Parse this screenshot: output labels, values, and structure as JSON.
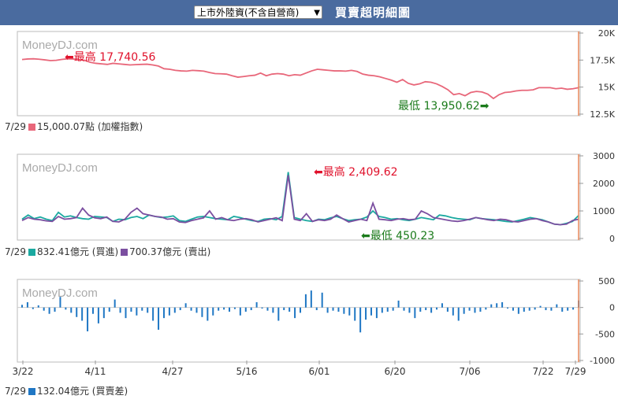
{
  "header": {
    "select_value": "上市外陸資(不含自營商)",
    "title": "買賣超明細圖"
  },
  "watermark": "MoneyDJ.com",
  "colors": {
    "header_bg": "#4a6b9f",
    "index_line": "#e8677a",
    "buy": "#1ba9a0",
    "sell": "#7b4fa0",
    "diff": "#1f77c4",
    "high_text": "#e0112b",
    "low_text": "#1a7a1a",
    "cursor": "#e8885a"
  },
  "chart_data": [
    {
      "type": "line",
      "name": "index",
      "y_ticks": [
        "20K",
        "17.5K",
        "15K",
        "12.5K"
      ],
      "ylim": [
        12500,
        20000
      ],
      "values": [
        17550,
        17600,
        17620,
        17580,
        17520,
        17450,
        17480,
        17560,
        17620,
        17600,
        17550,
        17480,
        17300,
        17200,
        17150,
        17100,
        17200,
        17150,
        17100,
        17050,
        17080,
        17100,
        17120,
        17050,
        16950,
        16700,
        16650,
        16550,
        16500,
        16480,
        16550,
        16520,
        16480,
        16350,
        16250,
        16230,
        16200,
        16050,
        15920,
        15980,
        16050,
        16100,
        16300,
        16050,
        16200,
        16250,
        16200,
        16050,
        16150,
        16100,
        16300,
        16500,
        16650,
        16600,
        16550,
        16500,
        16500,
        16480,
        16550,
        16450,
        16200,
        16100,
        16050,
        15950,
        15800,
        15650,
        15450,
        15700,
        15350,
        15200,
        15300,
        15500,
        15450,
        15300,
        15050,
        14750,
        14300,
        14400,
        14200,
        14500,
        14600,
        14550,
        14350,
        13950,
        14300,
        14500,
        14550,
        14650,
        14700,
        14700,
        14750,
        14950,
        14950,
        14950,
        14850,
        14900,
        14800,
        14850,
        14950
      ],
      "high_label": "最高 17,740.56",
      "low_label": "最低 13,950.62",
      "legend": "15,000.07點 (加權指數)",
      "date": "7/29"
    },
    {
      "type": "line",
      "name": "buy_sell",
      "y_ticks": [
        "3000",
        "2000",
        "1000",
        "0"
      ],
      "ylim": [
        0,
        3000
      ],
      "series": [
        {
          "name": "買進",
          "values": [
            700,
            850,
            720,
            780,
            700,
            650,
            950,
            780,
            820,
            760,
            720,
            700,
            800,
            780,
            760,
            620,
            700,
            680,
            760,
            800,
            720,
            850,
            800,
            760,
            780,
            820,
            650,
            620,
            700,
            780,
            800,
            760,
            720,
            700,
            680,
            800,
            760,
            700,
            650,
            620,
            700,
            720,
            680,
            800,
            2409.62,
            760,
            700,
            650,
            620,
            700,
            680,
            750,
            800,
            720,
            650,
            680,
            700,
            780,
            1000,
            800,
            760,
            700,
            720,
            680,
            650,
            700,
            760,
            720,
            680,
            850,
            820,
            760,
            720,
            700,
            680,
            760,
            720,
            700,
            680,
            650,
            620,
            600,
            650,
            700,
            760,
            720,
            680,
            600,
            520,
            500,
            550,
            620,
            832.41
          ]
        },
        {
          "name": "賣出",
          "values": [
            650,
            760,
            700,
            680,
            640,
            620,
            800,
            700,
            720,
            760,
            1100,
            850,
            750,
            720,
            780,
            620,
            600,
            700,
            950,
            1100,
            900,
            850,
            800,
            780,
            700,
            720,
            600,
            580,
            650,
            700,
            750,
            1000,
            700,
            760,
            680,
            650,
            700,
            720,
            680,
            600,
            650,
            700,
            750,
            650,
            2300,
            700,
            650,
            900,
            620,
            680,
            650,
            700,
            850,
            720,
            600,
            650,
            700,
            650,
            1280,
            700,
            680,
            650,
            700,
            720,
            680,
            700,
            1000,
            900,
            760,
            720,
            680,
            640,
            620,
            650,
            700,
            760,
            720,
            680,
            650,
            700,
            680,
            620,
            600,
            650,
            700,
            720,
            650,
            600,
            520,
            500,
            520,
            650,
            700.37
          ]
        }
      ],
      "high_label": "最高 2,409.62",
      "low_label": "最低 450.23",
      "legend_buy": "832.41億元 (買進)",
      "legend_sell": "700.37億元 (賣出)",
      "date": "7/29"
    },
    {
      "type": "bar",
      "name": "net",
      "y_ticks": [
        "500",
        "0",
        "-500",
        "-1000"
      ],
      "ylim": [
        -1000,
        500
      ],
      "values": [
        50,
        100,
        -30,
        40,
        -60,
        -120,
        -80,
        200,
        -40,
        -100,
        -180,
        -250,
        -450,
        -120,
        -300,
        -200,
        -80,
        150,
        -100,
        -200,
        -80,
        -150,
        -60,
        -100,
        -250,
        -420,
        -200,
        -150,
        -100,
        -50,
        80,
        -60,
        -100,
        -180,
        -250,
        -150,
        -60,
        -40,
        -80,
        -30,
        -150,
        -80,
        -50,
        100,
        -20,
        -60,
        -100,
        -250,
        -50,
        -80,
        -200,
        -100,
        250,
        320,
        -50,
        280,
        -100,
        -60,
        -80,
        -120,
        -150,
        -250,
        -470,
        -230,
        -150,
        -200,
        -100,
        -80,
        -60,
        130,
        -60,
        -100,
        -200,
        -80,
        -50,
        -100,
        -40,
        80,
        -80,
        -150,
        -250,
        -120,
        -60,
        -100,
        -80,
        -40,
        60,
        80,
        100,
        -20,
        -60,
        -120,
        -80,
        -60,
        -40,
        30,
        -50,
        -60,
        60,
        -80,
        -60,
        -40,
        132.04
      ],
      "x_ticks": [
        "3/22",
        "4/11",
        "4/27",
        "5/16",
        "6/01",
        "6/20",
        "7/06",
        "7/22",
        "7/29"
      ],
      "legend": "132.04億元 (買賣差)",
      "date": "7/29"
    }
  ]
}
